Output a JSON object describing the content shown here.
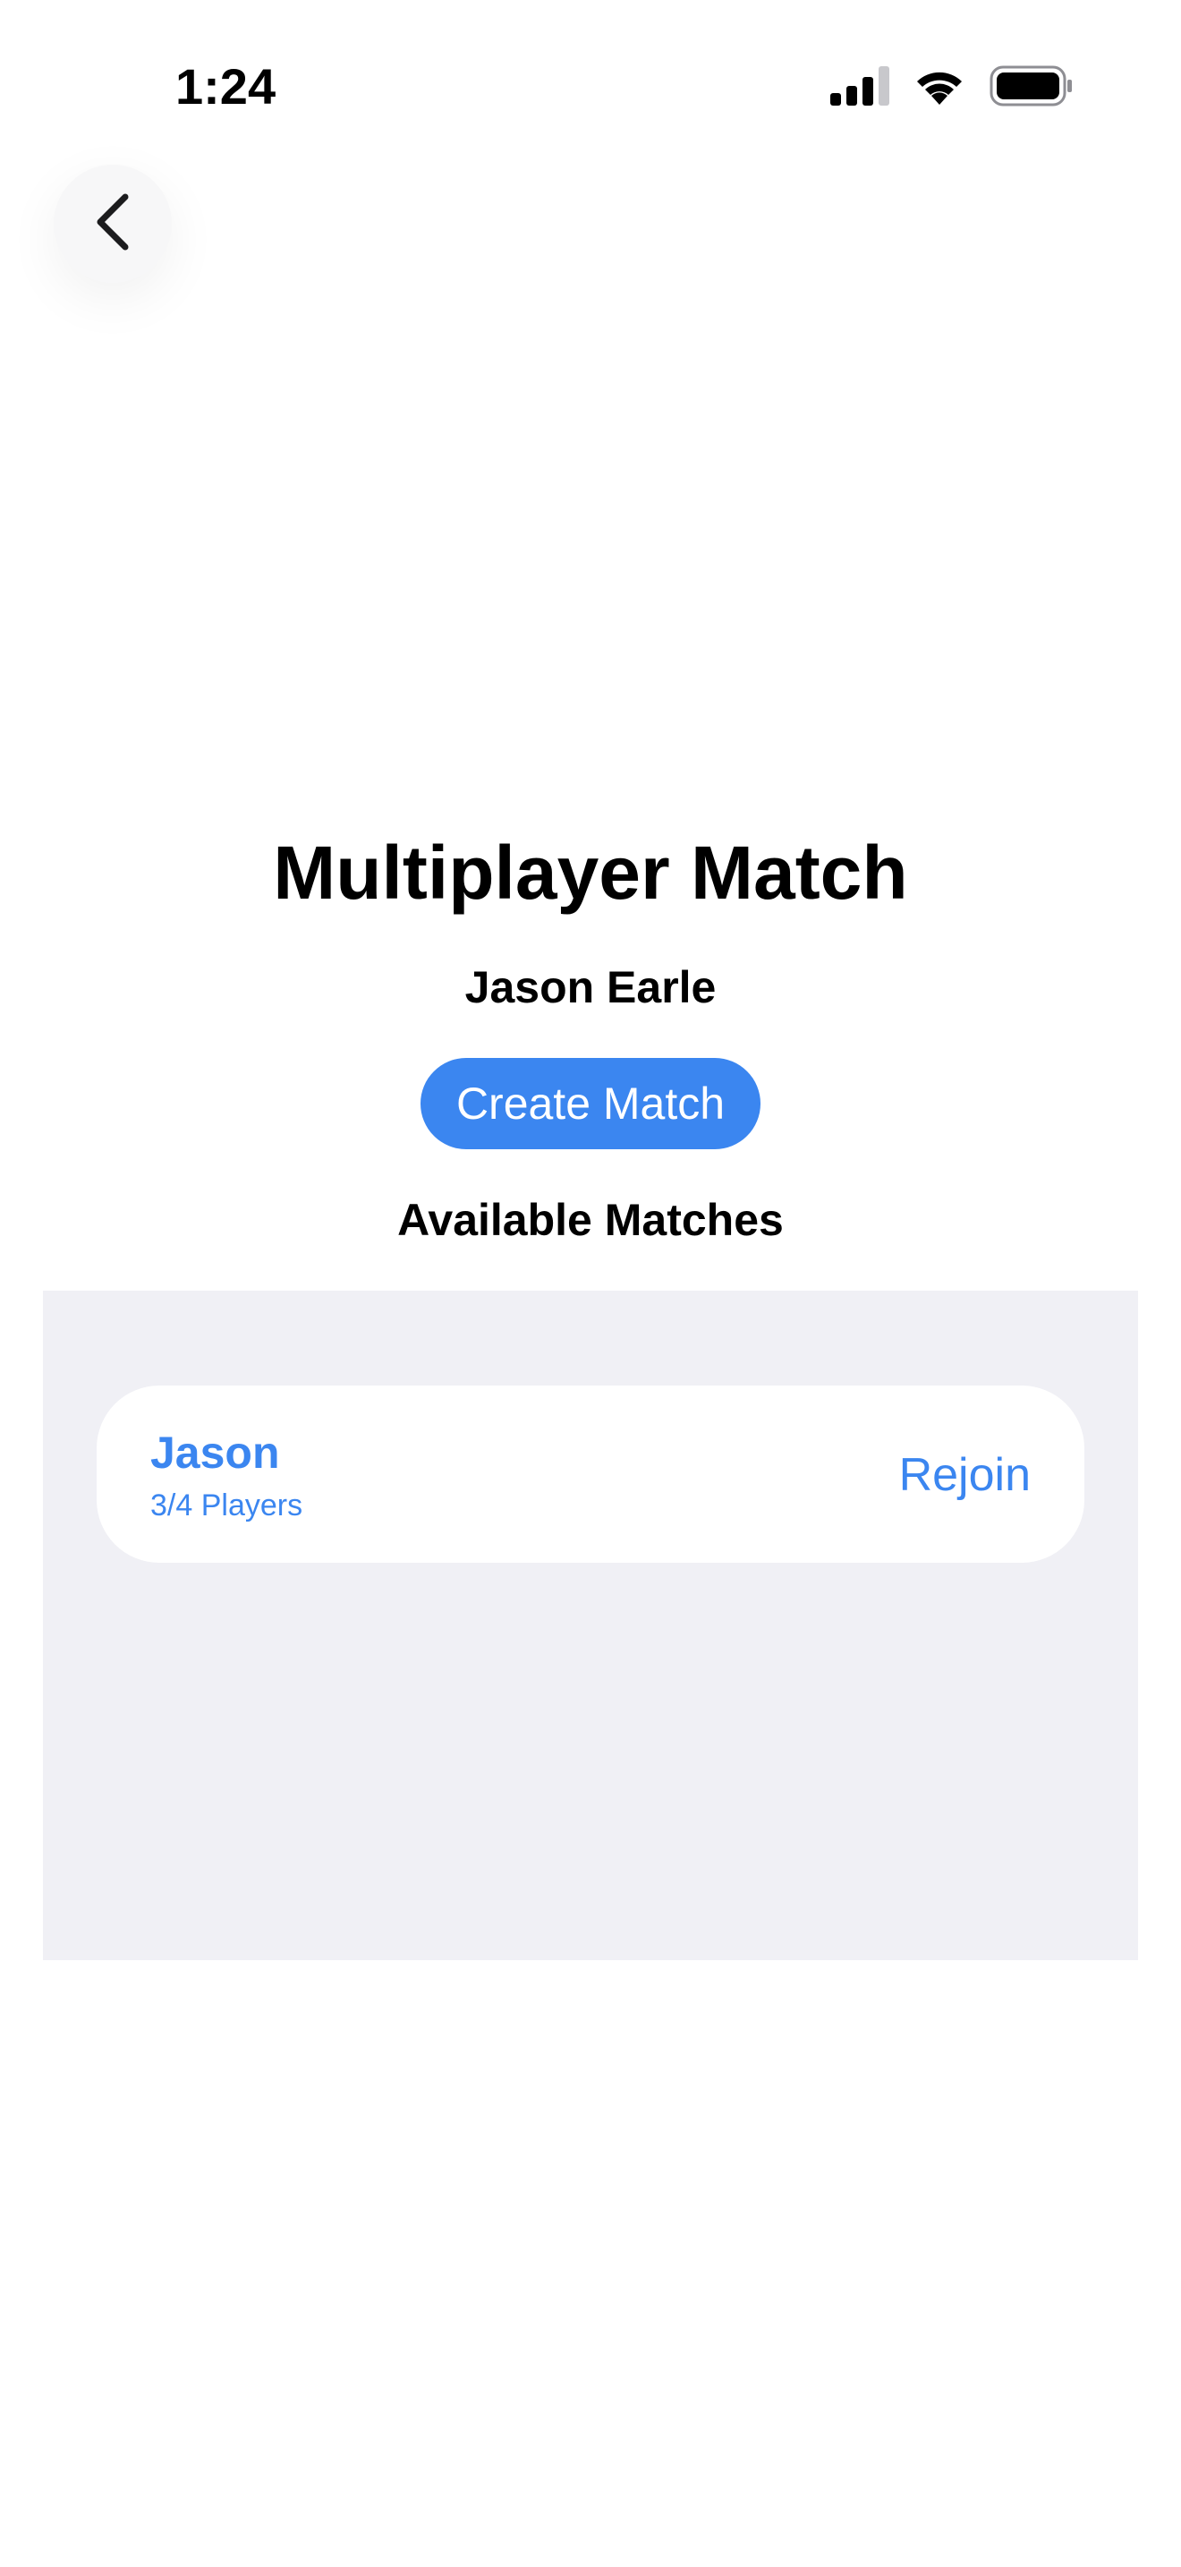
{
  "status_bar": {
    "time": "1:24",
    "signal_icon": "cellular-signal-icon",
    "wifi_icon": "wifi-icon",
    "battery_icon": "battery-icon"
  },
  "nav": {
    "back_icon": "chevron-left-icon"
  },
  "page": {
    "title": "Multiplayer Match",
    "player_name": "Jason Earle",
    "create_button_label": "Create Match",
    "section_title": "Available Matches"
  },
  "matches": [
    {
      "name": "Jason",
      "players": "3/4 Players",
      "action_label": "Rejoin"
    }
  ],
  "colors": {
    "accent": "#3b86f0",
    "list_background": "#f0f0f5",
    "card_background": "#ffffff"
  }
}
